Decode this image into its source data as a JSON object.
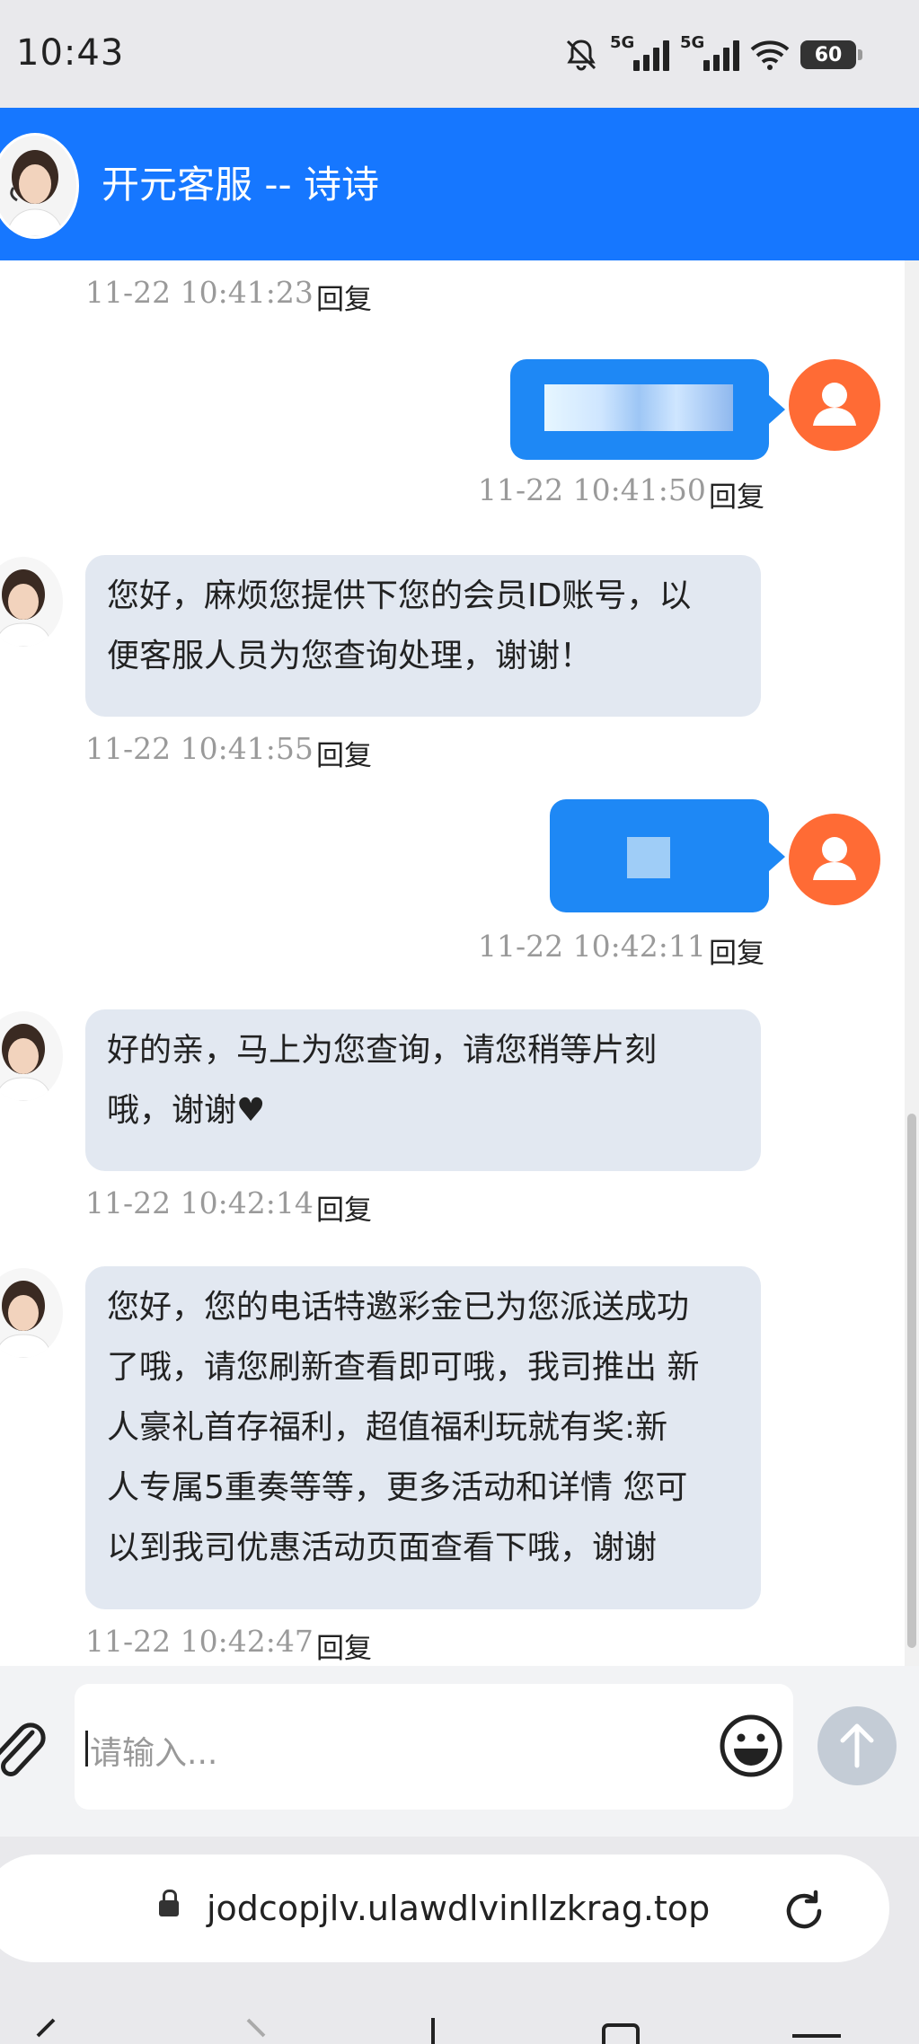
{
  "status_bar": {
    "time": "10:43",
    "network_1": "5G",
    "network_2": "5G",
    "battery": "60",
    "icons": [
      "bell-muted-icon",
      "signal-icon",
      "signal-icon",
      "wifi-icon",
      "battery-icon"
    ]
  },
  "header": {
    "title": "开元客服 -- 诗诗"
  },
  "messages": [
    {
      "side": "agent",
      "time": "11-22 10:41:23",
      "reply": "回复"
    },
    {
      "side": "user",
      "time": "11-22 10:41:50",
      "reply": "回复",
      "text": ""
    },
    {
      "side": "agent",
      "time": "11-22 10:41:55",
      "reply": "回复",
      "lines": [
        "您好，麻烦您提供下您的会员ID账号，以",
        "便客服人员为您查询处理，谢谢！"
      ]
    },
    {
      "side": "user",
      "time": "11-22 10:42:11",
      "reply": "回复",
      "text": ""
    },
    {
      "side": "agent",
      "time": "11-22 10:42:14",
      "reply": "回复",
      "lines": [
        "好的亲，马上为您查询，请您稍等片刻",
        "哦，谢谢♥"
      ]
    },
    {
      "side": "agent",
      "time": "11-22 10:42:47",
      "reply": "回复",
      "lines": [
        "您好，您的电话特邀彩金已为您派送成功",
        "了哦，请您刷新查看即可哦，我司推出 新",
        "人豪礼首存福利，超值福利玩就有奖:新",
        "人专属5重奏等等，更多活动和详情 您可",
        "以到我司优惠活动页面查看下哦，谢谢"
      ]
    }
  ],
  "composer": {
    "placeholder": "请输入..."
  },
  "browser": {
    "url": "jodcopjlv.ulawdlvinllzkrag.top"
  },
  "colors": {
    "header": "#1677ff",
    "user_bubble": "#1e88f5",
    "agent_bubble": "#e2e8f1",
    "user_avatar": "#ff6b35"
  }
}
